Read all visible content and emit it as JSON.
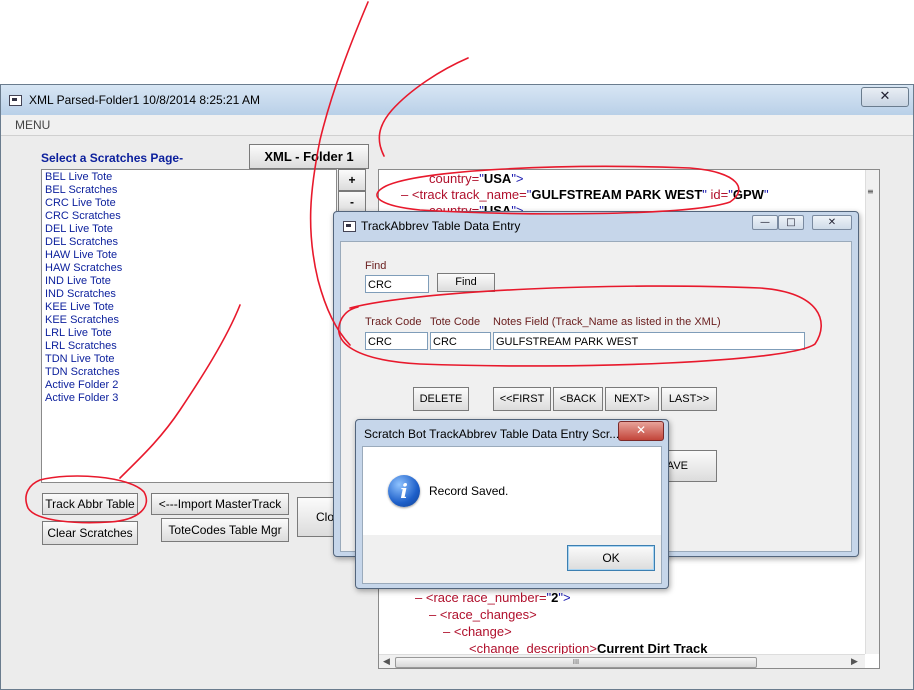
{
  "main_window": {
    "title": "XML Parsed-Folder1 10/8/2014 8:25:21 AM",
    "close_glyph": "✕",
    "menu": "MENU",
    "select_label": "Select a Scratches Page-",
    "folder_button": "XML - Folder 1",
    "list_items": [
      "BEL Live Tote",
      "BEL Scratches",
      "CRC Live Tote",
      "CRC Scratches",
      "DEL Live Tote",
      "DEL Scratches",
      "HAW Live Tote",
      "HAW Scratches",
      "IND Live Tote",
      "IND Scratches",
      "KEE Live Tote",
      "KEE Scratches",
      "LRL Live Tote",
      "LRL Scratches",
      "TDN Live Tote",
      "TDN Scratches",
      "Active Folder 2",
      "Active Folder 3"
    ],
    "plus": "+",
    "minus": "-",
    "buttons": {
      "track_abbr": "Track Abbr Table",
      "import_master": "<---Import MasterTrack List",
      "clear_scratches": "Clear Scratches",
      "totecodes": "ToteCodes Table Mgr",
      "partial_clo": "Clo"
    }
  },
  "xml_view": {
    "line1": {
      "attr": "country=",
      "q1": "\"",
      "val": "USA",
      "q2": "\">"
    },
    "line2": {
      "dash": "–",
      "tag": "<track track_name=",
      "q1": "\"",
      "val": "GULFSTREAM PARK WEST",
      "q2": "\"",
      "attr2": " id=",
      "q3": "\"",
      "val2": "GPW",
      "q4": "\""
    },
    "line3": {
      "attr": "country=",
      "q1": "\"",
      "val": "USA",
      "q2": "\">"
    },
    "race": {
      "dash": "–",
      "tag": "<race race_number=",
      "q1": "\"",
      "val": "2",
      "q2": "\">"
    },
    "race_changes": {
      "dash": "–",
      "tag": "<race_changes>"
    },
    "change": {
      "dash": "–",
      "tag": "<change>"
    },
    "change_desc": {
      "tag": "<change_description>",
      "val": "Current Dirt Track"
    },
    "scroll_thumb": "III"
  },
  "track_dialog": {
    "title": "TrackAbbrev Table Data Entry",
    "find_label": "Find",
    "find_value": "CRC",
    "find_button": "Find",
    "headers": {
      "track_code": "Track Code",
      "tote_code": "Tote Code",
      "notes": "Notes Field (Track_Name as listed in the XML)"
    },
    "values": {
      "track_code": "CRC",
      "tote_code": "CRC",
      "notes": "GULFSTREAM PARK WEST"
    },
    "nav": {
      "delete": "DELETE",
      "first": "<<FIRST",
      "back": "<BACK",
      "next": "NEXT>",
      "last": "LAST>>"
    },
    "partial_save": "AVE",
    "min": "—",
    "max": "□",
    "close": "✕"
  },
  "msgbox": {
    "title": "Scratch Bot TrackAbbrev Table Data Entry Scr...",
    "message": "Record Saved.",
    "ok": "OK",
    "close": "✕",
    "info_glyph": "i"
  },
  "colors": {
    "ink": "#e8192c",
    "list_text": "#0b1f9c",
    "xml_tag": "#b0102c",
    "xml_quote": "#1a1ab0"
  }
}
